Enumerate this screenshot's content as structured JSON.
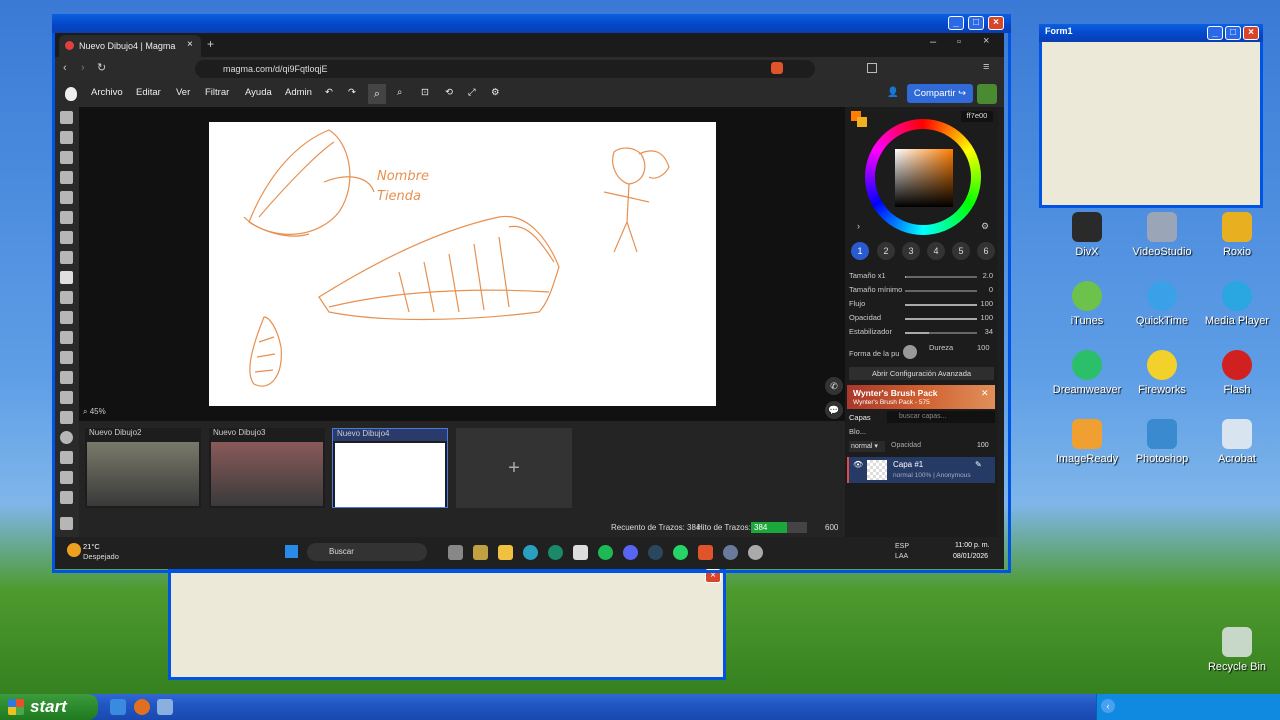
{
  "desktop": {
    "icons": [
      {
        "label": "DivX",
        "color": "#2a2a2a"
      },
      {
        "label": "VideoStudio",
        "color": "#9aa5b8"
      },
      {
        "label": "Roxio",
        "color": "#e8b020"
      },
      {
        "label": "iTunes",
        "color": "#6cc24a"
      },
      {
        "label": "QuickTime",
        "color": "#3aa0e8"
      },
      {
        "label": "Media Player",
        "color": "#2aa6e0"
      },
      {
        "label": "Dreamweaver",
        "color": "#2cbf6a"
      },
      {
        "label": "Fireworks",
        "color": "#f2d22a"
      },
      {
        "label": "Flash",
        "color": "#d02020"
      },
      {
        "label": "ImageReady",
        "color": "#f0a030"
      },
      {
        "label": "Photoshop",
        "color": "#3a8ad0"
      },
      {
        "label": "Acrobat",
        "color": "#d8e4f0"
      },
      {
        "label": "Recycle Bin",
        "color": "#c8d8c8"
      }
    ]
  },
  "xp_taskbar": {
    "start_label": "start"
  },
  "form1": {
    "title": "Form1"
  },
  "browser": {
    "tab_title": "Nuevo Dibujo4 | Magma",
    "url": "magma.com/d/qi9FqtloqjE",
    "menu": [
      "Archivo",
      "Editar",
      "Ver",
      "Filtrar",
      "Ayuda",
      "Admin"
    ],
    "share_label": "Compartir",
    "zoom": "45%",
    "sketch_text": [
      "Nombre",
      "Tienda"
    ],
    "drawings": [
      {
        "title": "Nuevo Dibujo2"
      },
      {
        "title": "Nuevo Dibujo3"
      },
      {
        "title": "Nuevo Dibujo4"
      }
    ],
    "add_label": "+",
    "status": {
      "strokes_label": "Recuento de Trazos: 384",
      "limit_label": "Hito de Trazos:",
      "current": "384",
      "max": "600",
      "progress": 0.64
    },
    "color": {
      "hex": "ff7e00"
    },
    "brush_slots": [
      "1",
      "2",
      "3",
      "4",
      "5",
      "6"
    ],
    "settings": [
      {
        "label": "Tamaño x1",
        "value": "2.0",
        "fill": 0.02
      },
      {
        "label": "Tamaño mínimo",
        "value": "0",
        "fill": 0.0
      },
      {
        "label": "Flujo",
        "value": "100",
        "fill": 1.0
      },
      {
        "label": "Opacidad",
        "value": "100",
        "fill": 1.0
      },
      {
        "label": "Estabilizador",
        "value": "34",
        "fill": 0.34
      }
    ],
    "tip_shape_label": "Forma de la pu",
    "hardness_label": "Dureza",
    "hardness_value": "100",
    "advanced_label": "Abrir Configuración Avanzada",
    "promo": {
      "title": "Wynter's Brush Pack",
      "subtitle": "Wynter's Brush Pack - 575"
    },
    "layers": {
      "tab": "Capas",
      "search_placeholder": "buscar capas...",
      "lock_label": "Blo...",
      "blend": "normal",
      "opacity_label": "Opacidad",
      "opacity_value": "100",
      "layer_name": "Capa #1",
      "layer_meta": "normal 100% | Anonymous"
    },
    "win_taskbar": {
      "weather_temp": "21°C",
      "weather_desc": "Despejado",
      "search_label": "Buscar",
      "lang": "ESP",
      "lang2": "LAA",
      "time": "11:00 p. m.",
      "date": "08/01/2026"
    }
  }
}
